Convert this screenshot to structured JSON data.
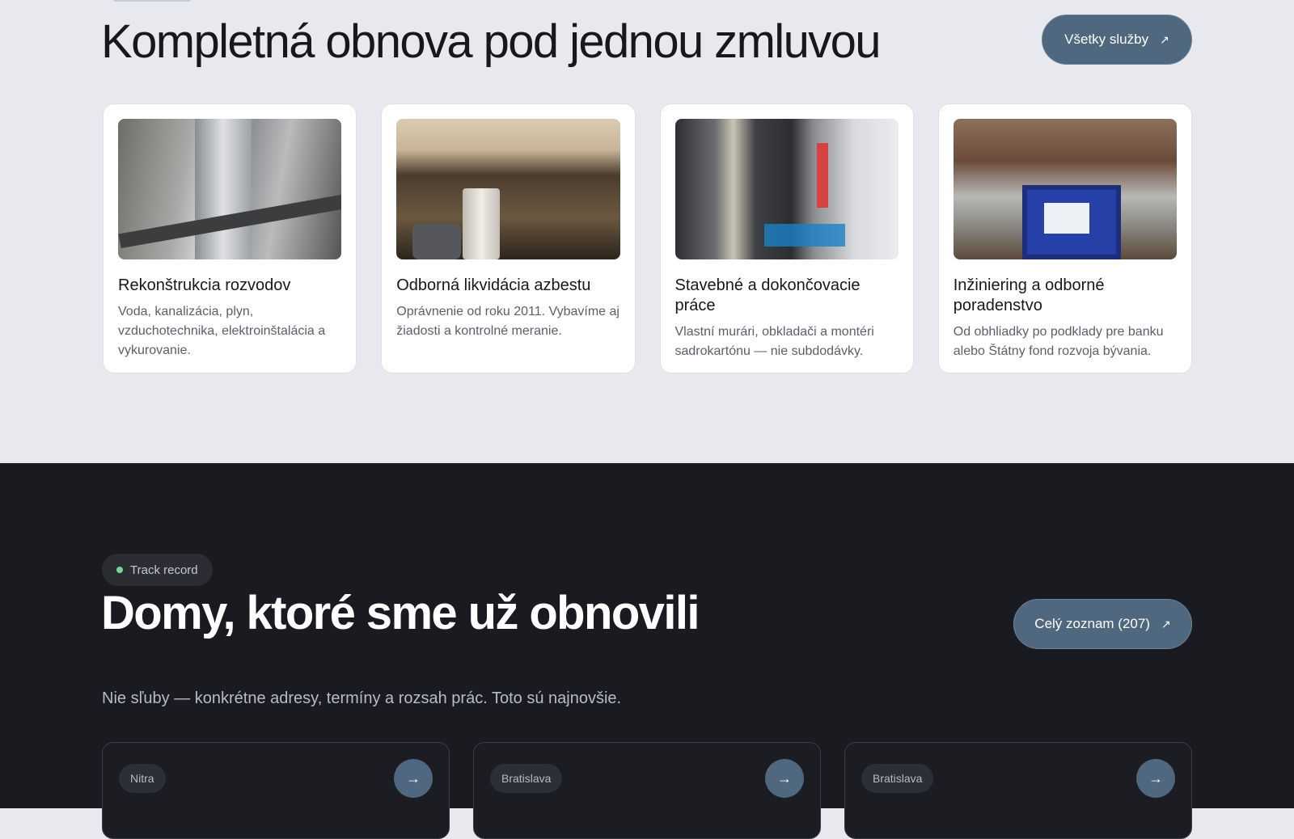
{
  "services": {
    "heading": "Kompletná obnova pod jednou zmluvou",
    "all_button": "Všetky služby",
    "all_button_icon": "arrow-up-right-icon",
    "cards": [
      {
        "title": "Rekonštrukcia rozvodov",
        "desc": "Voda, kanalizácia, plyn, vzduchotechnika, elektroinštalácia a vykurovanie.",
        "image": "ventilation-ducts-photo"
      },
      {
        "title": "Odborná likvidácia azbestu",
        "desc": "Oprávnenie od roku 2011. Vybavíme aj žiadosti a kontrolné meranie.",
        "image": "asbestos-shaft-photo"
      },
      {
        "title": "Stavebné a dokončovacie práce",
        "desc": "Vlastní murári, obkladači a montéri sadrokartónu — nie subdodávky.",
        "image": "pipes-installation-photo"
      },
      {
        "title": "Inžiniering a odborné poradenstvo",
        "desc": "Od obhliadky po podklady pre banku alebo Štátny fond rozvoja bývania.",
        "image": "bathroom-frame-photo"
      }
    ]
  },
  "track": {
    "badge": "Track record",
    "heading": "Domy, ktoré sme už obnovili",
    "list_button": "Celý zoznam (207)",
    "list_button_icon": "arrow-up-right-icon",
    "subtitle": "Nie sľuby — konkrétne adresy, termíny a rozsah prác. Toto sú najnovšie.",
    "projects": [
      {
        "city": "Nitra"
      },
      {
        "city": "Bratislava"
      },
      {
        "city": "Bratislava"
      }
    ]
  },
  "colors": {
    "accent": "#4f677f",
    "light_bg": "#e7e9ee",
    "dark_bg": "#191b20",
    "badge_dot": "#7fd39a"
  }
}
